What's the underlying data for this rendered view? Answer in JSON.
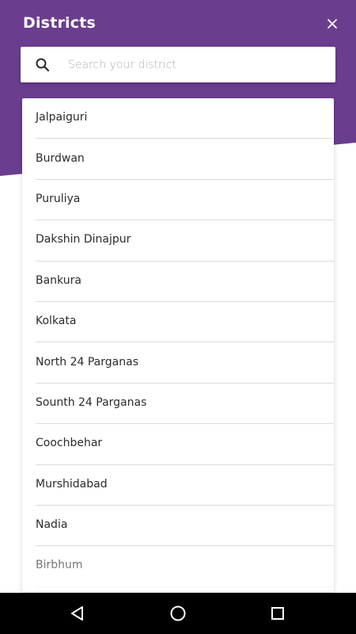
{
  "header": {
    "title": "Districts",
    "background_color": "#6b3d8e"
  },
  "search": {
    "placeholder": "Search your district",
    "value": ""
  },
  "districts": [
    "Jalpaiguri",
    "Burdwan",
    "Puruliya",
    "Dakshin Dinajpur",
    "Bankura",
    "Kolkata",
    "North 24 Parganas",
    "Sounth 24 Parganas",
    "Coochbehar",
    "Murshidabad",
    "Nadia",
    "Birbhum"
  ],
  "icons": {
    "close": "close-icon",
    "search": "search-icon",
    "nav_back": "back-triangle-icon",
    "nav_home": "home-circle-icon",
    "nav_recents": "recents-square-icon"
  }
}
